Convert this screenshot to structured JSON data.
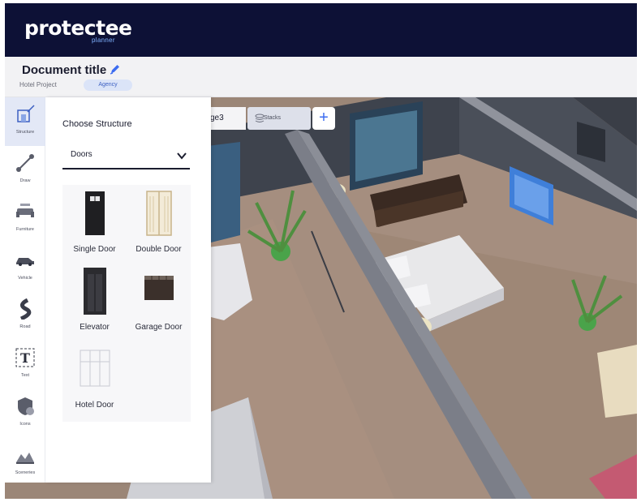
{
  "app": {
    "logo_text": "protectee",
    "logo_sub": "planner",
    "brand_color": "#0d1136",
    "accent_color": "#3c6cf0"
  },
  "document": {
    "title": "Document title",
    "project": "Hotel Project",
    "badge": "Agency"
  },
  "tabs": [
    {
      "label": "ge3"
    },
    {
      "label": "Stacks",
      "icon": "stack-icon"
    },
    {
      "label": "+",
      "icon": "plus-icon"
    }
  ],
  "toolbar": [
    {
      "label": "Structure",
      "icon": "structure-icon",
      "active": true
    },
    {
      "label": "Draw",
      "icon": "draw-icon"
    },
    {
      "label": "Furniture",
      "icon": "furniture-icon"
    },
    {
      "label": "Vehicle",
      "icon": "vehicle-icon"
    },
    {
      "label": "Road",
      "icon": "road-icon"
    },
    {
      "label": "Text",
      "icon": "text-icon"
    },
    {
      "label": "Icons",
      "icon": "icons-icon"
    },
    {
      "label": "Sceneries",
      "icon": "sceneries-icon"
    }
  ],
  "panel": {
    "title": "Choose Structure",
    "dropdown_value": "Doors",
    "items": [
      {
        "name": "Single Door",
        "icon": "single-door-icon"
      },
      {
        "name": "Double Door",
        "icon": "double-door-icon"
      },
      {
        "name": "Elevator",
        "icon": "elevator-icon"
      },
      {
        "name": "Garage Door",
        "icon": "garage-door-icon"
      },
      {
        "name": "Hotel Door",
        "icon": "hotel-door-icon"
      }
    ]
  }
}
